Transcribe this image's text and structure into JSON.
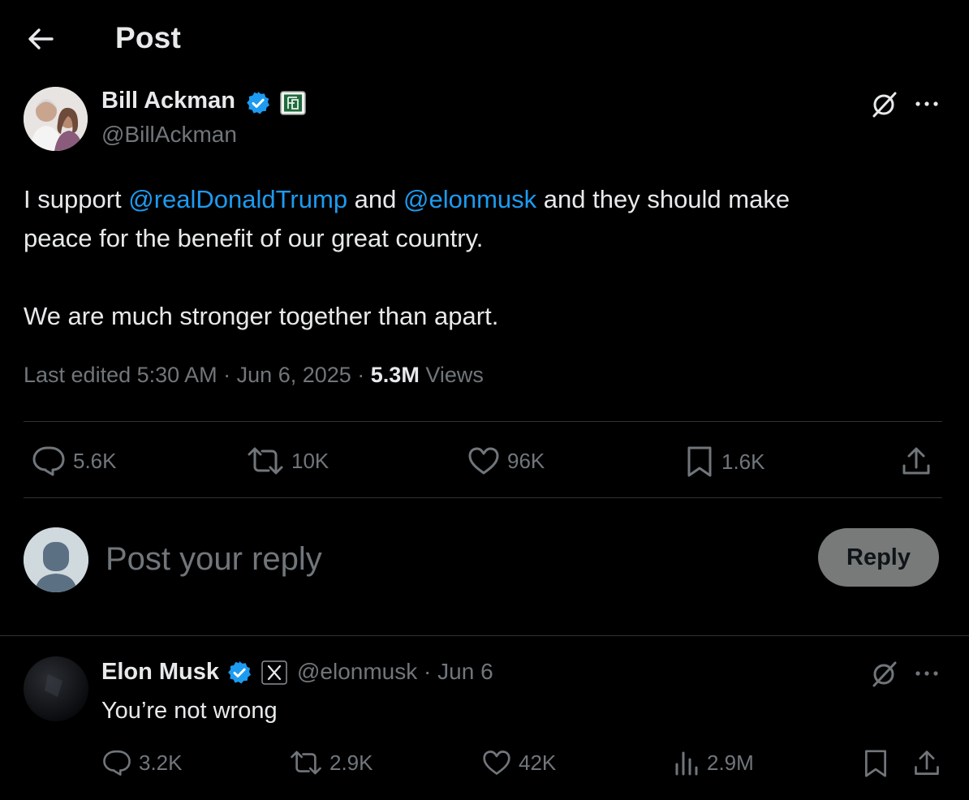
{
  "header": {
    "back_icon": "arrow-left-icon",
    "title": "Post"
  },
  "post": {
    "author_name": "Bill Ackman",
    "author_handle": "@BillAckman",
    "verified_color": "#1d9bf0",
    "text_line1_pre": "I support ",
    "mention1": "@realDonaldTrump",
    "text_line1_mid": " and ",
    "mention2": "@elonmusk",
    "text_line1_post": " and they should make",
    "text_line2": "peace for the benefit of our great country.",
    "text_line3": "We are much stronger together than apart.",
    "edited_label": "Last edited 5:30 AM · Jun 6, 2025 · ",
    "views_count": "5.3M",
    "views_label": " Views",
    "actions": {
      "replies": "5.6K",
      "reposts": "10K",
      "likes": "96K",
      "bookmarks": "1.6K"
    }
  },
  "composer": {
    "placeholder": "Post your reply",
    "button_label": "Reply"
  },
  "reply": {
    "author_name": "Elon Musk",
    "handle_date": "@elonmusk · Jun 6",
    "text": "You’re not wrong",
    "actions": {
      "replies": "3.2K",
      "reposts": "2.9K",
      "likes": "42K",
      "views": "2.9M"
    }
  },
  "colors": {
    "background": "#000000",
    "text_primary": "#e7e9ea",
    "text_secondary": "#71767b",
    "accent": "#1d9bf0",
    "divider": "#2f3336",
    "reply_button_bg": "#787a7a"
  }
}
